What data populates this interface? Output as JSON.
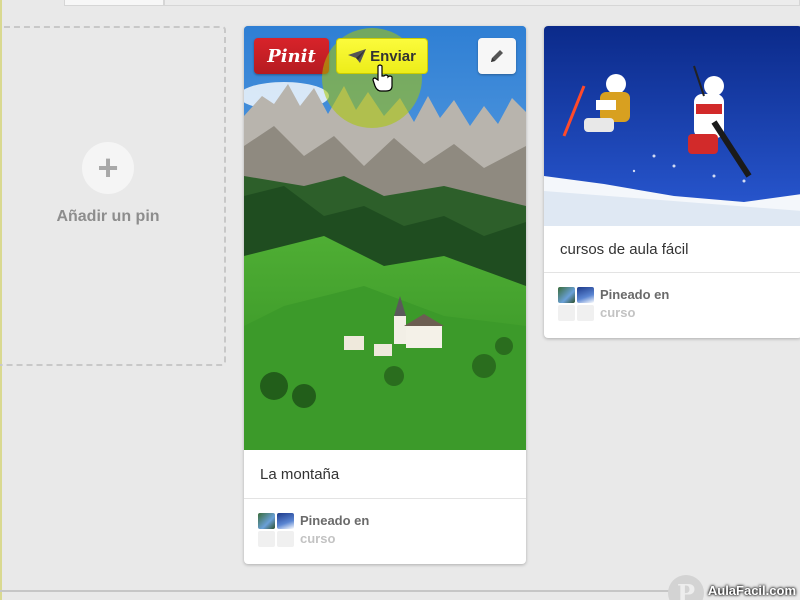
{
  "add_pin": {
    "label": "Añadir un pin"
  },
  "pin_mountain": {
    "pinit_label": "Pinit",
    "send_label": "Enviar",
    "description": "La montaña",
    "pinned_in": "Pineado en",
    "board": "curso"
  },
  "pin_ski": {
    "description": "cursos de aula fácil",
    "pinned_in": "Pineado en",
    "board": "curso"
  },
  "watermark": "AulaFacil.com",
  "colors": {
    "pinit_red": "#c9202a",
    "send_yellow": "#f4f42a",
    "background": "#e9e9e9"
  },
  "icons": {
    "add": "plus-icon",
    "send": "paper-plane-icon",
    "edit": "pencil-icon",
    "cursor": "hand-pointer-icon",
    "logo": "pinterest-logo-icon"
  }
}
